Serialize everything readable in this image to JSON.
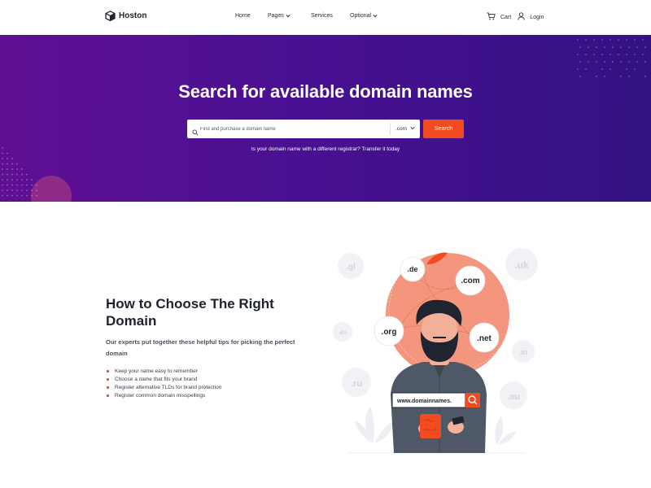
{
  "brand": {
    "name": "Hoston"
  },
  "nav": {
    "menu": [
      {
        "label": "Home",
        "has_dropdown": false
      },
      {
        "label": "Pages",
        "has_dropdown": true
      },
      {
        "label": "Services",
        "has_dropdown": false
      },
      {
        "label": "Optional",
        "has_dropdown": true
      }
    ],
    "cart_label": "Cart",
    "login_label": "Login"
  },
  "hero": {
    "title": "Search for available domain names",
    "search_placeholder": "Find and purchase a domain name",
    "tld_selected": ".com",
    "search_button": "Search",
    "transfer_text": "Is your domain name with a different registrar? Transfer it today"
  },
  "content": {
    "title": "How to Choose The Right Domain",
    "subtitle": "Our experts put together these helpful tips for picking the perfect domain",
    "tips": [
      "Keep your name easy to remember",
      "Choose a name that fits your brand",
      "Register alternative TLDs for brand protection",
      "Register common domain misspellings"
    ]
  },
  "illustration": {
    "bubbles_primary": [
      ".de",
      ".com",
      ".org",
      ".net"
    ],
    "bubbles_faded": [
      ".gl",
      ".uk",
      ".es",
      ".in",
      ".ru",
      ".au"
    ],
    "sign_text": "www.domainnames."
  },
  "colors": {
    "hero_start": "#5f0f92",
    "hero_end": "#321281",
    "accent": "#f24b20",
    "illustration_circle": "#f4967e"
  }
}
